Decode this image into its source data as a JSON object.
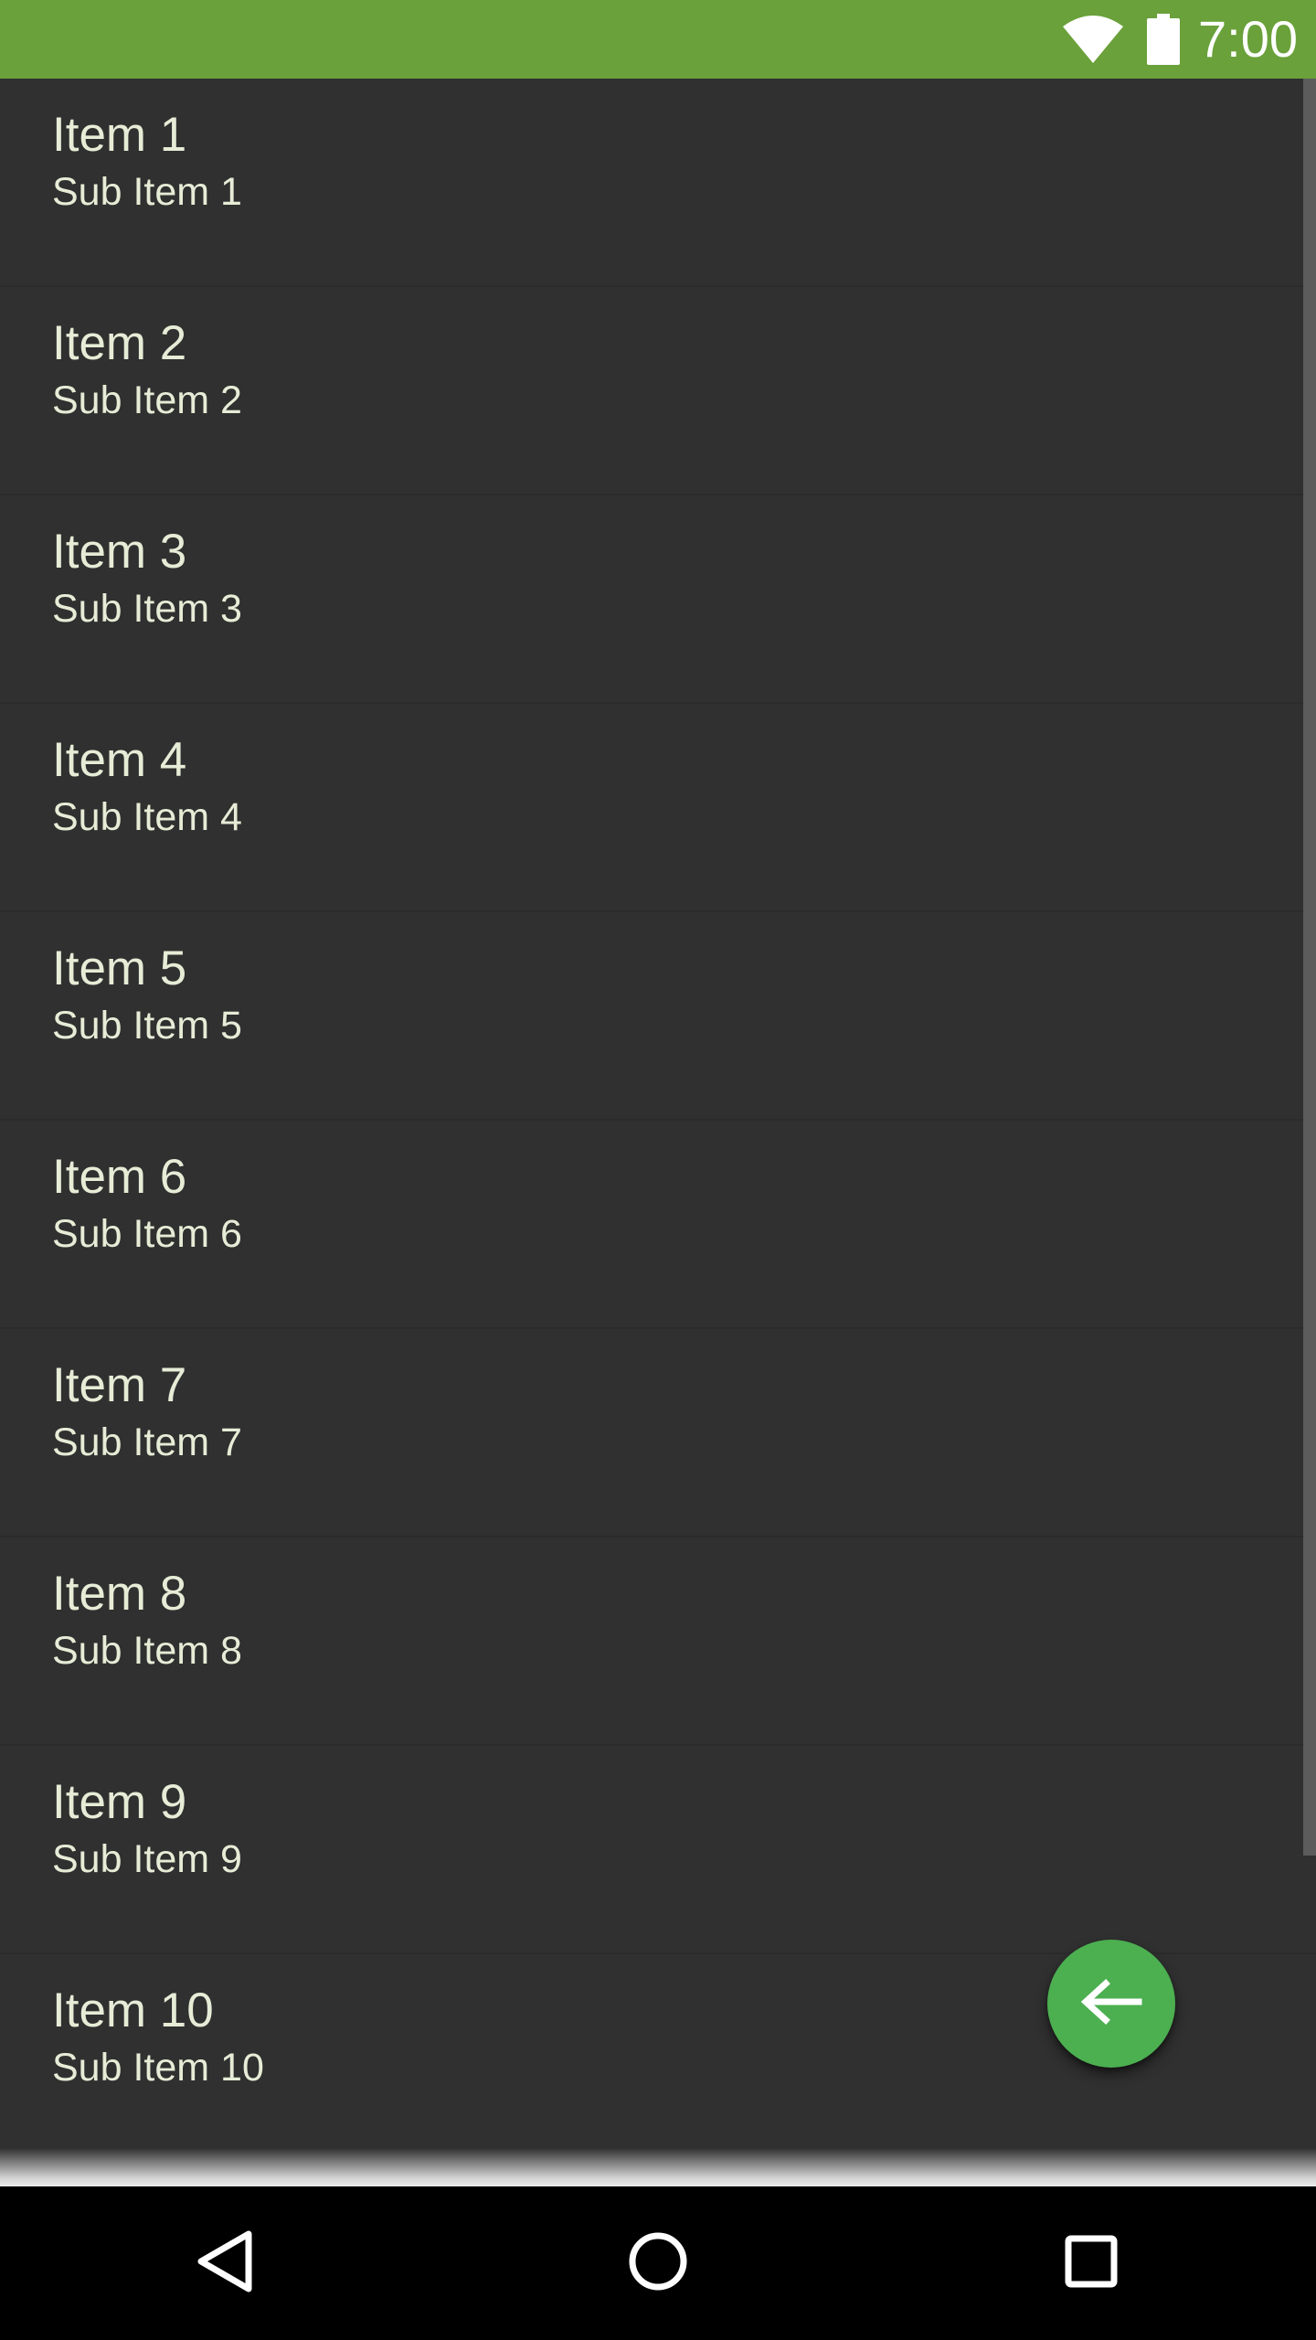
{
  "status_bar": {
    "time": "7:00",
    "background_color": "#6aa13a",
    "icons": [
      "wifi-icon",
      "battery-icon"
    ]
  },
  "list": {
    "items": [
      {
        "title": "Item 1",
        "subtitle": "Sub Item 1"
      },
      {
        "title": "Item 2",
        "subtitle": "Sub Item 2"
      },
      {
        "title": "Item 3",
        "subtitle": "Sub Item 3"
      },
      {
        "title": "Item 4",
        "subtitle": "Sub Item 4"
      },
      {
        "title": "Item 5",
        "subtitle": "Sub Item 5"
      },
      {
        "title": "Item 6",
        "subtitle": "Sub Item 6"
      },
      {
        "title": "Item 7",
        "subtitle": "Sub Item 7"
      },
      {
        "title": "Item 8",
        "subtitle": "Sub Item 8"
      },
      {
        "title": "Item 9",
        "subtitle": "Sub Item 9"
      },
      {
        "title": "Item 10",
        "subtitle": "Sub Item 10"
      }
    ],
    "background_color": "#303030",
    "text_color": "#e6ecd6"
  },
  "fab": {
    "icon": "arrow-back-icon",
    "color": "#4caf50"
  },
  "nav_bar": {
    "buttons": [
      "back-triangle-icon",
      "home-circle-icon",
      "recents-square-icon"
    ]
  }
}
